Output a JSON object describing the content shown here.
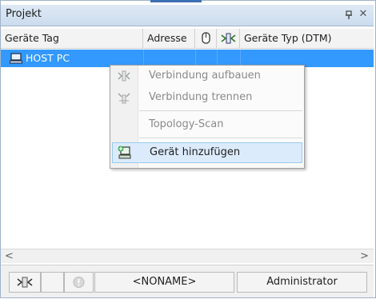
{
  "panel": {
    "title": "Projekt"
  },
  "columns": [
    {
      "label": "Geräte Tag"
    },
    {
      "label": "Adresse"
    },
    {
      "label": ""
    },
    {
      "label": ""
    },
    {
      "label": "Geräte Typ (DTM)"
    }
  ],
  "tree": {
    "selected_label": "HOST PC"
  },
  "context_menu": {
    "items": [
      {
        "label": "Verbindung aufbauen",
        "enabled": false,
        "icon": "connect-icon"
      },
      {
        "label": "Verbindung trennen",
        "enabled": false,
        "icon": "disconnect-icon"
      },
      {
        "label": "Topology-Scan",
        "enabled": false,
        "icon": ""
      },
      {
        "label": "Gerät hinzufügen",
        "enabled": true,
        "icon": "add-device-icon"
      }
    ]
  },
  "statusbar": {
    "project_name": "<NONAME>",
    "user_role": "Administrator"
  },
  "colors": {
    "selection": "#3399ff",
    "title_gradient_top": "#dfe9f5",
    "title_gradient_bottom": "#cbdcee",
    "menu_hover": "#dcebfc"
  }
}
